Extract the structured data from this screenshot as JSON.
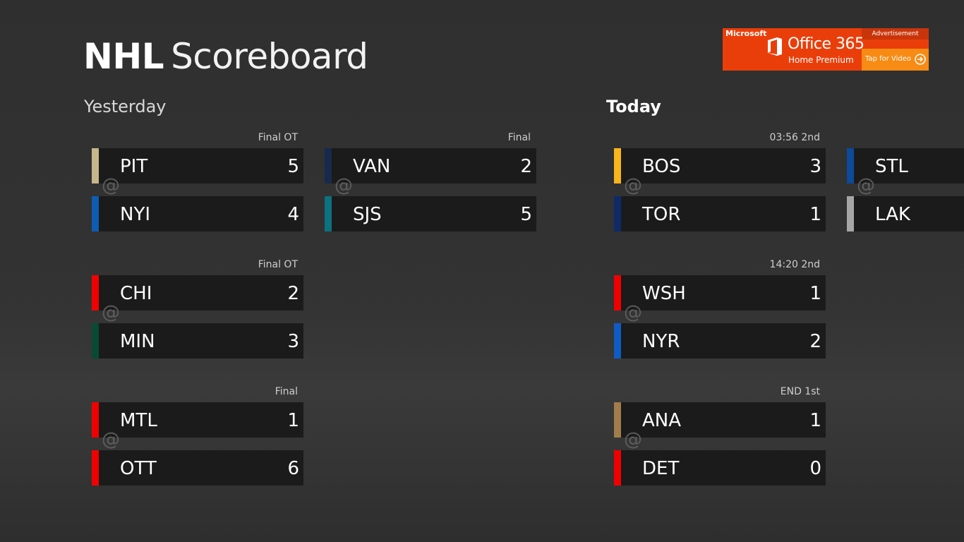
{
  "app": {
    "title_bold": "NHL",
    "title_light": "Scoreboard"
  },
  "ad": {
    "brand": "Microsoft",
    "label": "Advertisement",
    "product": "Office 365",
    "edition": "Home Premium",
    "cta": "Tap for Video",
    "logo_icon": "office-logo-icon",
    "cta_icon": "arrow-circle-icon",
    "colors": {
      "background": "#ea3e0a",
      "cta_background": "#f78b14"
    }
  },
  "sections": {
    "yesterday": {
      "heading": "Yesterday",
      "games": [
        {
          "status": "Final OT",
          "away": {
            "abbr": "PIT",
            "score": "5",
            "color": "#c5b68b"
          },
          "at": "@",
          "home": {
            "abbr": "NYI",
            "score": "4",
            "color": "#0f5cb3"
          }
        },
        {
          "status": "Final",
          "away": {
            "abbr": "VAN",
            "score": "2",
            "color": "#17294d"
          },
          "at": "@",
          "home": {
            "abbr": "SJS",
            "score": "5",
            "color": "#0c7180"
          }
        },
        {
          "status": "Final OT",
          "away": {
            "abbr": "CHI",
            "score": "2",
            "color": "#f00000"
          },
          "at": "@",
          "home": {
            "abbr": "MIN",
            "score": "3",
            "color": "#0a4a33"
          }
        },
        {
          "status": "Final",
          "away": {
            "abbr": "MTL",
            "score": "1",
            "color": "#f00000"
          },
          "at": "@",
          "home": {
            "abbr": "OTT",
            "score": "6",
            "color": "#f00000"
          }
        }
      ]
    },
    "today": {
      "heading": "Today",
      "games": [
        {
          "status": "03:56 2nd",
          "away": {
            "abbr": "BOS",
            "score": "3",
            "color": "#f8b51c"
          },
          "at": "@",
          "home": {
            "abbr": "TOR",
            "score": "1",
            "color": "#0f2a66"
          }
        },
        {
          "status": "",
          "away": {
            "abbr": "STL",
            "score": "",
            "color": "#0c4a9a"
          },
          "at": "@",
          "home": {
            "abbr": "LAK",
            "score": "",
            "color": "#a6a6a6"
          }
        },
        {
          "status": "14:20 2nd",
          "away": {
            "abbr": "WSH",
            "score": "1",
            "color": "#f00000"
          },
          "at": "@",
          "home": {
            "abbr": "NYR",
            "score": "2",
            "color": "#0f5cc4"
          }
        },
        {
          "status": "END 1st",
          "away": {
            "abbr": "ANA",
            "score": "1",
            "color": "#a17d4b"
          },
          "at": "@",
          "home": {
            "abbr": "DET",
            "score": "0",
            "color": "#f00000"
          }
        }
      ]
    }
  }
}
